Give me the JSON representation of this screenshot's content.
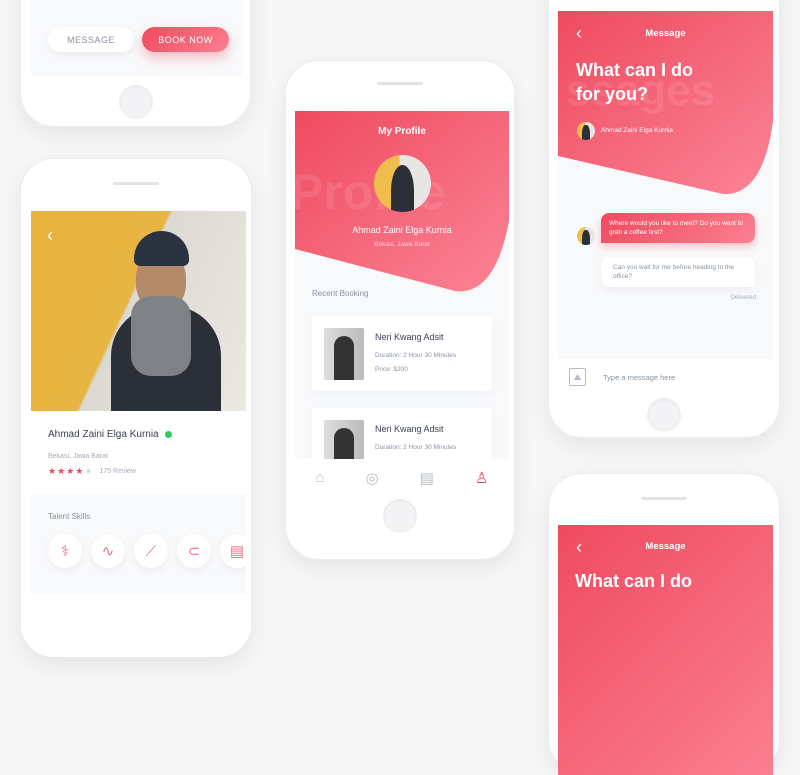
{
  "colors": {
    "accent": "#ef4a5f",
    "accent_light": "#fb7f90",
    "verified": "#2ecc55"
  },
  "booking_phone": {
    "message_label": "MESSAGE",
    "book_label": "BOOK NOW"
  },
  "detail_phone": {
    "name": "Ahmad Zaini Elga Kurnia",
    "location": "Bekasi, Jawa Barat",
    "rating": 4,
    "rating_max": 5,
    "reviews": "175 Review",
    "skills_title": "Talent Skills",
    "skills": [
      "doctor-icon",
      "stethoscope-icon",
      "syringe-icon",
      "sewing-machine-icon",
      "device-icon"
    ]
  },
  "profile_phone": {
    "title": "My Profile",
    "watermark": "Profile",
    "name": "Ahmad Zaini Elga Kurnia",
    "location": "Bekasi, Jawa Barat",
    "section": "Recent Booking",
    "bookings": [
      {
        "name": "Neri Kwang Adsit",
        "duration": "Duration: 2 Hour 30 Minutes",
        "price": "Price: $200"
      },
      {
        "name": "Neri Kwang Adsit",
        "duration": "Duration: 2 Hour 30 Minutes"
      }
    ],
    "nav": [
      "home-icon",
      "compass-icon",
      "document-icon",
      "user-icon"
    ],
    "active_nav": 3
  },
  "message_phone": {
    "title": "Message",
    "heading": "What can I do for you?",
    "watermark": "ssages",
    "user": "Ahmad Zaini Elga Kurnia",
    "messages": [
      {
        "text": "Where would you like to meet? Do you want to grab a coffee first?",
        "from": "other"
      },
      {
        "text": "Can you wait for me before heading to the office?",
        "from": "me"
      }
    ],
    "status": "Delivered",
    "input_placeholder": "Type a message here"
  },
  "message_phone_2": {
    "title": "Message",
    "heading": "What can I do"
  }
}
